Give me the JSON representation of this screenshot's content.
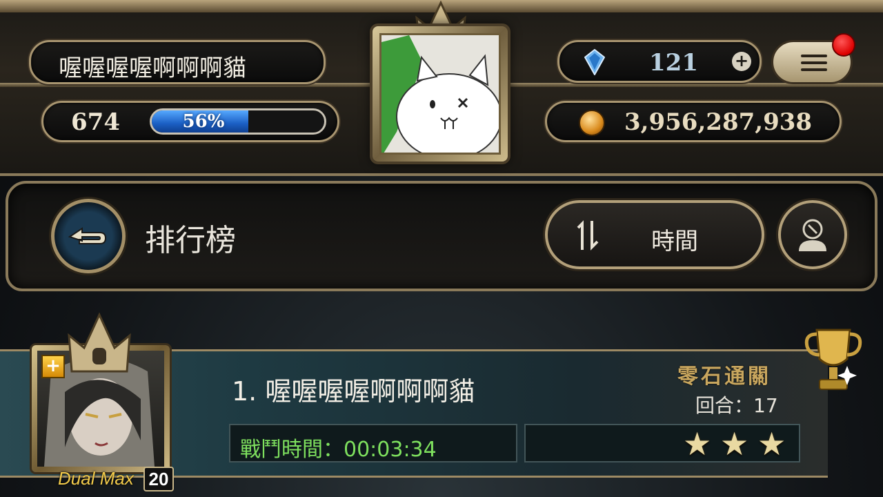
{
  "player": {
    "name": "喔喔喔喔啊啊啊貓",
    "level": "674",
    "exp_percent": 56,
    "exp_label": "56%"
  },
  "currency": {
    "gems": "121",
    "coins": "3,956,287,938"
  },
  "header": {
    "title": "排行榜",
    "sort_label": "時間"
  },
  "entry": {
    "rank_name": "1. 喔喔喔喔啊啊啊貓",
    "battle_time": "戰鬥時間：00:03:34",
    "clear_label": "零石通關",
    "round_label": "回合：17",
    "stars": 3,
    "dual_label": "Dual Max",
    "dual_level": "20"
  },
  "icons": {
    "back": "back-arrow-icon",
    "sort": "sort-arrows-icon",
    "profile": "profile-block-icon",
    "menu": "hamburger-menu-icon",
    "gem": "diamond-gem-icon",
    "coin": "gold-coin-icon",
    "trophy": "trophy-icon"
  },
  "colors": {
    "accent_gold": "#a89570",
    "exp_blue": "#1b5fc4",
    "time_green": "#7ee05e",
    "notification_red": "#dd0000"
  }
}
